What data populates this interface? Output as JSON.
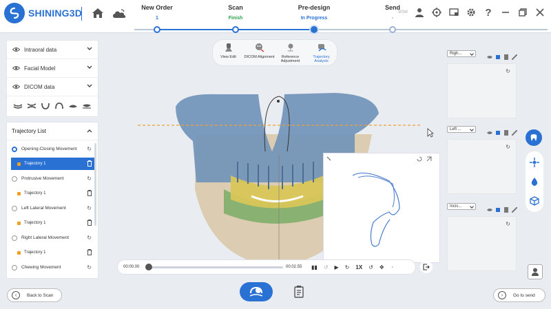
{
  "app": {
    "brand": "SHINING3D"
  },
  "steps": [
    {
      "title": "New Order",
      "status": "1",
      "color": "#2a71d4"
    },
    {
      "title": "Scan",
      "status": "Finish",
      "color": "#2aa04a"
    },
    {
      "title": "Pre-design",
      "status": "In Progress",
      "color": "#2a71d4"
    },
    {
      "title": "Send",
      "status": "-",
      "color": "#888888"
    }
  ],
  "header": {
    "small_text": "BSW"
  },
  "left_panel": {
    "data_items": [
      {
        "label": "Intraoral data"
      },
      {
        "label": "Facial Model"
      },
      {
        "label": "DICOM data"
      }
    ]
  },
  "trajectory_list": {
    "title": "Trajectory List",
    "movements": [
      {
        "label": "Opening-Closing Movement",
        "trajectory": "Trajectory 1",
        "selected": true
      },
      {
        "label": "Protrusive Movement",
        "trajectory": "Trajectory 1",
        "selected": false
      },
      {
        "label": "Left Lateral Movement",
        "trajectory": "Trajectory 1",
        "selected": false
      },
      {
        "label": "Right Lateral Movement",
        "trajectory": "Trajectory 1",
        "selected": false
      },
      {
        "label": "Chewing Movement"
      }
    ]
  },
  "toolbar": {
    "items": [
      {
        "label": "View Edit"
      },
      {
        "label": "DICOM Alignment"
      },
      {
        "label": "Reference Adjustment"
      },
      {
        "label": "Trajectory Analysis"
      }
    ]
  },
  "playback": {
    "current": "00:00.00",
    "total": "00:02.55",
    "speed": "1X",
    "progress": 0
  },
  "right_panel": {
    "views": [
      {
        "select": "Righ..."
      },
      {
        "select": "Left ..."
      },
      {
        "select": "Incis..."
      }
    ]
  },
  "buttons": {
    "back": "Back to Scan",
    "next": "Go to send"
  },
  "colors": {
    "accent": "#2a71d4",
    "finish": "#2aa04a",
    "trajectory_dot": "#f0a020"
  }
}
